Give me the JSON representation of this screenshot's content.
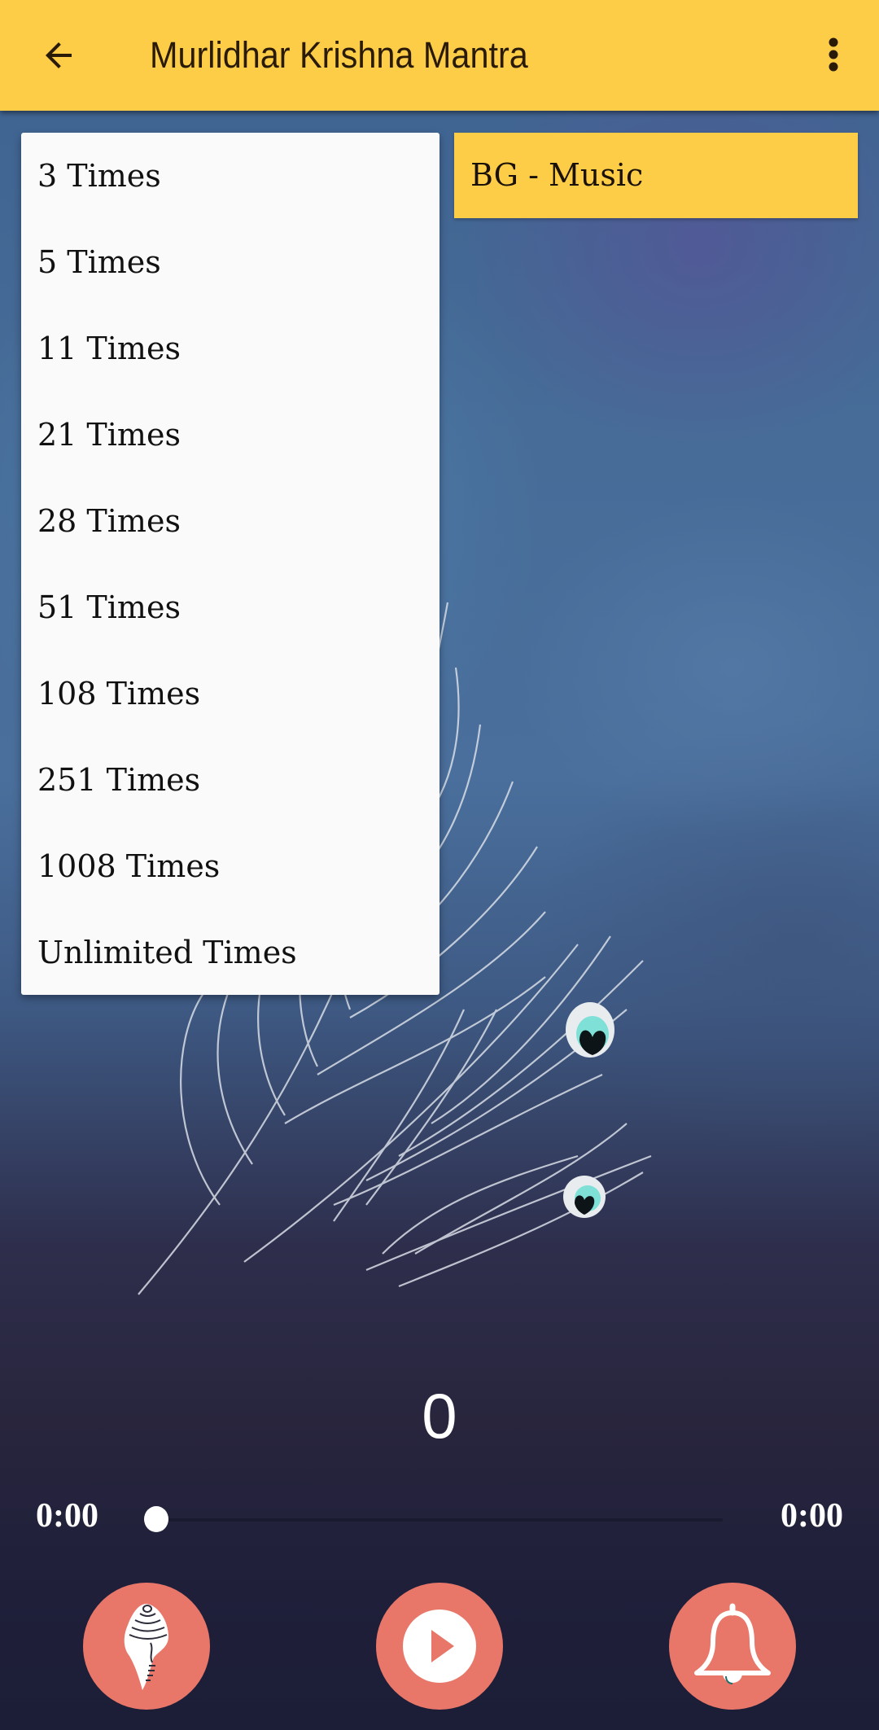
{
  "app_bar": {
    "title": "Murlidhar Krishna Mantra",
    "back_icon": "arrow-left-icon",
    "menu_icon": "more-vert-icon",
    "background_color": "#fdcd48"
  },
  "repeat_dropdown": {
    "options": [
      {
        "label": "3 Times"
      },
      {
        "label": "5 Times"
      },
      {
        "label": "11 Times"
      },
      {
        "label": "21 Times"
      },
      {
        "label": "28 Times"
      },
      {
        "label": "51 Times"
      },
      {
        "label": "108 Times"
      },
      {
        "label": "251 Times"
      },
      {
        "label": "1008 Times"
      },
      {
        "label": "Unlimited Times"
      }
    ]
  },
  "bg_music_button": {
    "label": "BG - Music"
  },
  "player": {
    "counter": "0",
    "elapsed_time": "0:00",
    "total_time": "0:00",
    "progress_percent": 0
  },
  "controls": {
    "conch_icon": "conch-shell-icon",
    "play_icon": "play-icon",
    "bell_icon": "bell-icon",
    "button_color": "#e8776a"
  }
}
